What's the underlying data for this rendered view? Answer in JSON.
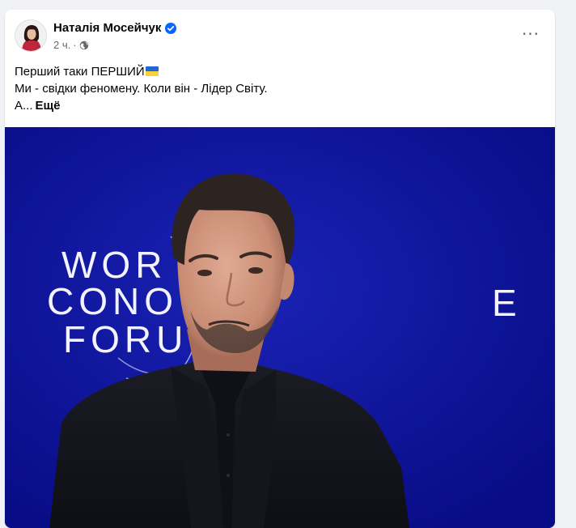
{
  "post": {
    "author": {
      "name": "Наталія Мосейчук",
      "verified": true
    },
    "time": "2 ч.",
    "separator": "·",
    "audience_icon": "globe-icon",
    "more_label": "···",
    "text": {
      "line1": "Перший таки ПЕРШИЙ",
      "line1_emoji": "ukraine-flag",
      "line2": "Ми - свідки феномену. Коли він - Лідер Світу.",
      "line3": "А...",
      "see_more": "Ещё"
    }
  },
  "media": {
    "backdrop_text": [
      "WOR",
      "CONO",
      "FORU",
      "E"
    ]
  },
  "colors": {
    "accent": "#0866ff",
    "stage_blue": "#0c119b",
    "secondary_text": "#65676b",
    "card": "#ffffff",
    "page_bg": "#f0f2f5"
  }
}
